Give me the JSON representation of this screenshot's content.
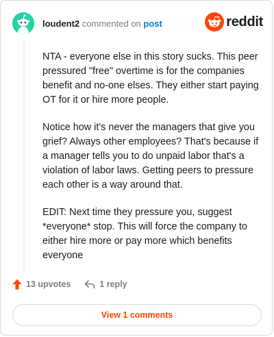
{
  "header": {
    "username": "loudent2",
    "action": "commented on",
    "link": "post",
    "brand": "reddit"
  },
  "comment": {
    "paragraphs": [
      "NTA - everyone else in this story sucks. This peer pressured \"free\" overtime is for the companies benefit and no-one elses. They either start paying OT for it or hire more people.",
      "Notice how it's never the managers that give you grief? Always other employees? That's because if a manager tells you to do unpaid labor that's a violation of labor laws. Getting peers to pressure each other is a way around that.",
      "EDIT: Next time they pressure you, suggest *everyone* stop. This will force the company to either hire more or pay more which benefits everyone"
    ]
  },
  "footer": {
    "upvotes": "13 upvotes",
    "replies": "1 reply",
    "view_comments": "View 1 comments"
  },
  "colors": {
    "avatar_bg": "#24d3a3",
    "brand_orange": "#ff4500",
    "link_blue": "#0079d3",
    "muted_text": "#7c7c7c"
  },
  "icons": [
    "snoo-avatar-icon",
    "reddit-logo-icon",
    "upvote-arrow-icon",
    "reply-arrow-icon"
  ]
}
